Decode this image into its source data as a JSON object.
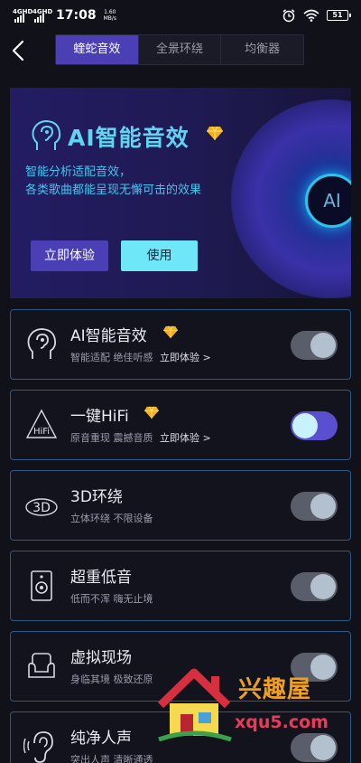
{
  "status_bar": {
    "net1": "4G",
    "net1_sup": "HD",
    "net2": "4G",
    "net2_sup": "HD",
    "time": "17:08",
    "speed_value": "1.60",
    "speed_unit": "MB/s",
    "battery": "51"
  },
  "nav": {
    "tabs": [
      {
        "label": "蝰蛇音效",
        "active": true
      },
      {
        "label": "全景环绕",
        "active": false
      },
      {
        "label": "均衡器",
        "active": false
      }
    ]
  },
  "banner": {
    "title": "AI智能音效",
    "desc_line1": "智能分析适配音效，",
    "desc_line2": "各类歌曲都能呈现无懈可击的效果",
    "try_label": "立即体验",
    "use_label": "使用",
    "disc_label": "AI"
  },
  "cards": [
    {
      "title": "AI智能音效",
      "subtitle": "智能适配 绝佳听感",
      "link": "立即体验 >",
      "vip": true,
      "icon": "ai-ear-icon",
      "toggle_on": false
    },
    {
      "title": "一键HiFi",
      "subtitle": "原音重现 震撼音质",
      "link": "立即体验 >",
      "vip": true,
      "icon": "hifi-icon",
      "icon_text": "HiFi",
      "toggle_on": true
    },
    {
      "title": "3D环绕",
      "subtitle": "立体环绕 不限设备",
      "link": "",
      "vip": false,
      "icon": "3d-icon",
      "icon_text": "3D",
      "toggle_on": false
    },
    {
      "title": "超重低音",
      "subtitle": "低而不浑 嗨无止境",
      "link": "",
      "vip": false,
      "icon": "speaker-icon",
      "toggle_on": false
    },
    {
      "title": "虚拟现场",
      "subtitle": "身临其境 极致还原",
      "link": "",
      "vip": false,
      "icon": "sofa-icon",
      "toggle_on": false
    },
    {
      "title": "纯净人声",
      "subtitle": "突出人声 清晰通透",
      "link": "",
      "vip": false,
      "icon": "ear-icon",
      "toggle_on": false
    }
  ],
  "watermark": {
    "name": "兴趣屋",
    "url": "xqu5.com"
  },
  "colors": {
    "accent_purple": "#4b3fb5",
    "accent_cyan": "#5fd5f2",
    "card_border": "#2c5a86",
    "vip_gold": "#f3b21b"
  }
}
